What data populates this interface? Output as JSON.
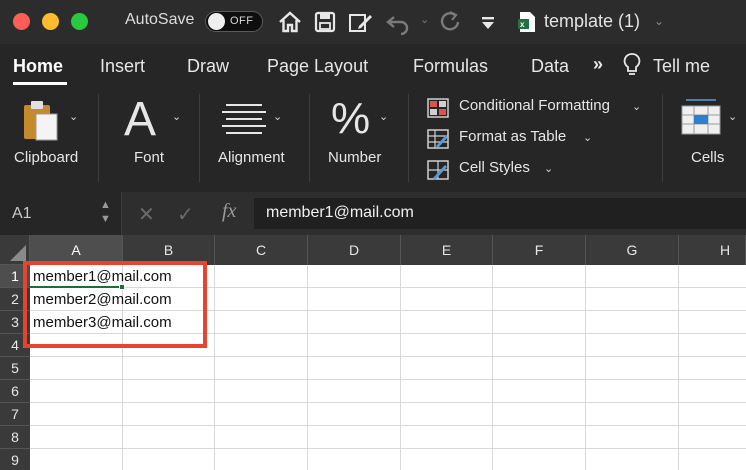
{
  "titlebar": {
    "autosave_label": "AutoSave",
    "autosave_state": "OFF",
    "document_title": "template (1)",
    "icons": [
      "home-icon",
      "save-icon",
      "edit-icon",
      "undo-icon",
      "redo-icon",
      "customize-icon"
    ]
  },
  "tabs": [
    {
      "label": "Home",
      "active": true
    },
    {
      "label": "Insert"
    },
    {
      "label": "Draw"
    },
    {
      "label": "Page Layout"
    },
    {
      "label": "Formulas"
    },
    {
      "label": "Data"
    },
    {
      "label": "Tell me"
    }
  ],
  "ribbon": {
    "clipboard_label": "Clipboard",
    "font_label": "Font",
    "font_glyph": "A",
    "alignment_label": "Alignment",
    "number_label": "Number",
    "number_glyph": "%",
    "conditional_formatting": "Conditional Formatting",
    "format_as_table": "Format as Table",
    "cell_styles": "Cell Styles",
    "cells_label": "Cells"
  },
  "formula_bar": {
    "name_box": "A1",
    "formula_value": "member1@mail.com"
  },
  "sheet": {
    "columns": [
      "A",
      "B",
      "C",
      "D",
      "E",
      "F",
      "G",
      "H"
    ],
    "rows": [
      "1",
      "2",
      "3",
      "4",
      "5",
      "6",
      "7",
      "8",
      "9"
    ],
    "selected_cell": "A1",
    "cells": [
      "member1@mail.com",
      "member2@mail.com",
      "member3@mail.com"
    ]
  },
  "colors": {
    "highlight": "#e8432e",
    "selection": "#1e6e3c",
    "ribbon_bg": "#262626"
  }
}
